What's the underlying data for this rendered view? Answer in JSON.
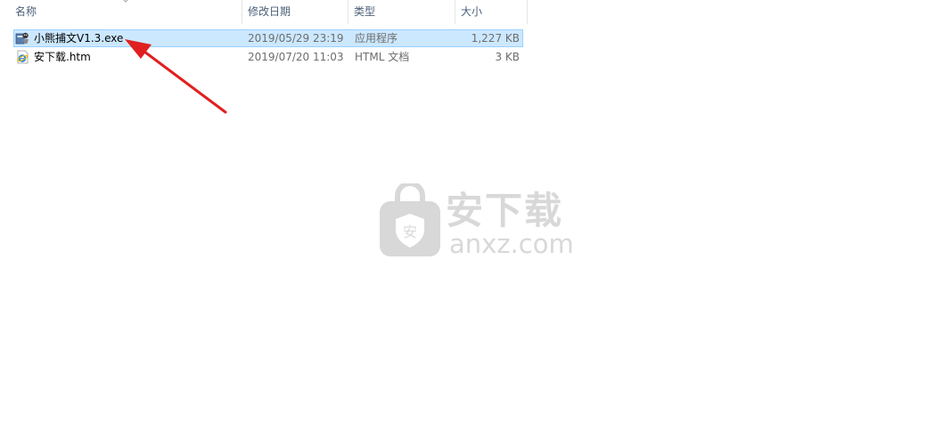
{
  "columns": {
    "name": "名称",
    "modified": "修改日期",
    "type": "类型",
    "size": "大小"
  },
  "files": [
    {
      "name": "小熊捕文V1.3.exe",
      "modified": "2019/05/29 23:19",
      "type": "应用程序",
      "size": "1,227 KB",
      "icon": "application-icon",
      "selected": true
    },
    {
      "name": "安下载.htm",
      "modified": "2019/07/20 11:03",
      "type": "HTML 文档",
      "size": "3 KB",
      "icon": "internet-explorer-icon",
      "selected": false
    }
  ],
  "annotation": {
    "color": "#e02020"
  },
  "watermark": {
    "text_cn": "安下载",
    "text_en": "anxz.com",
    "badge_char": "安",
    "color": "#b9b9b9"
  },
  "colors": {
    "selection_fill": "#cce8ff",
    "selection_border": "#99d1ff",
    "header_text": "#4c607a"
  }
}
